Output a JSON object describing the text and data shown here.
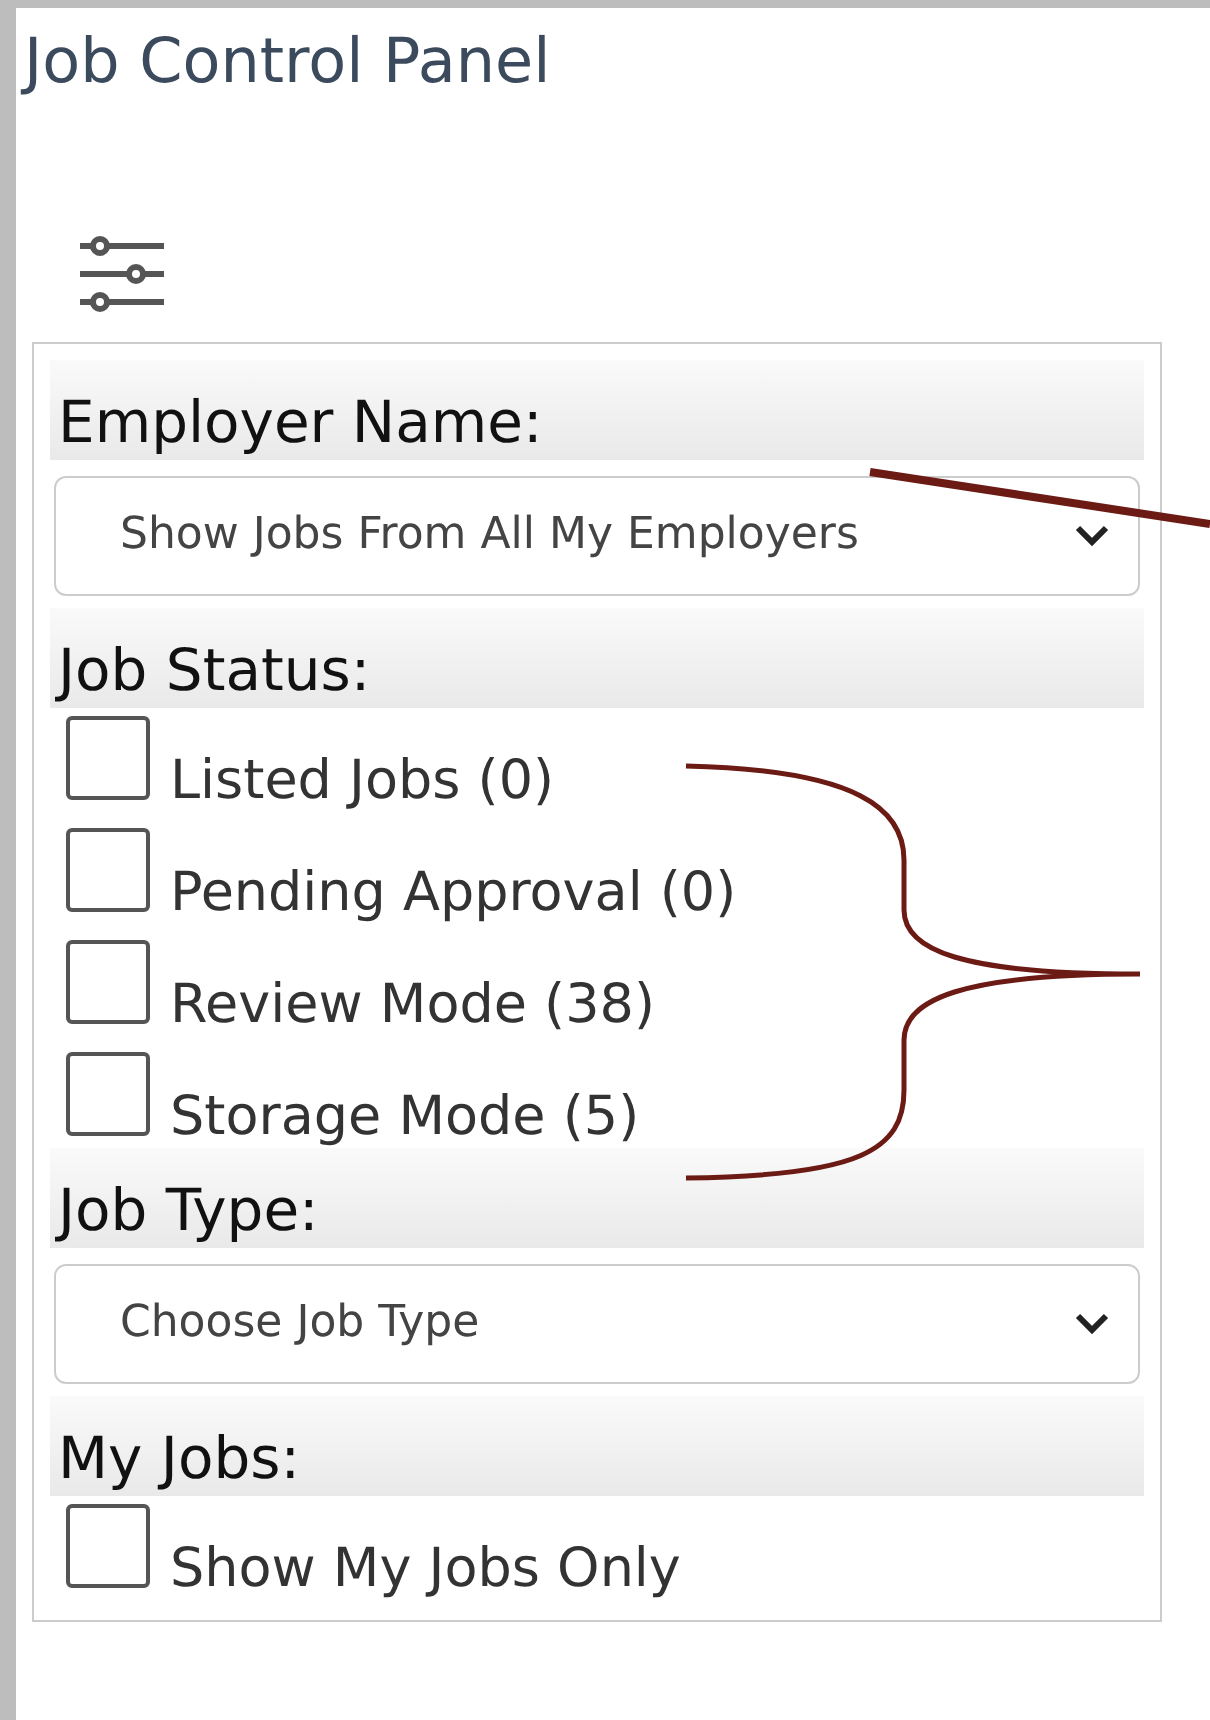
{
  "title": "Job Control Panel",
  "sections": [
    {
      "kind": "select",
      "heading": "Employer Name:",
      "value": "Show Jobs From All My Employers"
    },
    {
      "kind": "checkboxes",
      "heading": "Job Status:",
      "options": [
        {
          "label": "Listed Jobs (0)",
          "checked": false
        },
        {
          "label": "Pending Approval (0)",
          "checked": false
        },
        {
          "label": "Review Mode (38)",
          "checked": false
        },
        {
          "label": "Storage Mode (5)",
          "checked": false
        }
      ]
    },
    {
      "kind": "select",
      "heading": "Job Type:",
      "value": "Choose Job Type"
    },
    {
      "kind": "checkboxes",
      "heading": "My Jobs:",
      "options": [
        {
          "label": "Show My Jobs Only",
          "checked": false
        }
      ]
    }
  ]
}
